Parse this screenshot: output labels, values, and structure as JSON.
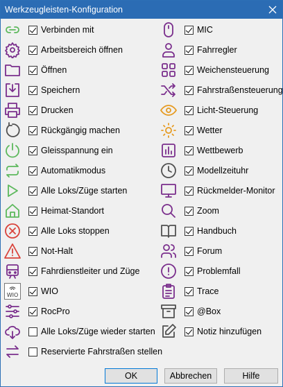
{
  "window": {
    "title": "Werkzeugleisten-Konfiguration"
  },
  "colors": {
    "green": "#5cb85c",
    "purple": "#7a2e8c",
    "red": "#d9423a",
    "orange": "#e69b22",
    "gray": "#505050",
    "titlebar": "#2b6cb4"
  },
  "left": [
    {
      "icon": "link-icon",
      "label": "Verbinden mit",
      "checked": true
    },
    {
      "icon": "gear-icon",
      "label": "Arbeitsbereich öffnen",
      "checked": true
    },
    {
      "icon": "folder-icon",
      "label": "Öffnen",
      "checked": true
    },
    {
      "icon": "save-icon",
      "label": "Speichern",
      "checked": true
    },
    {
      "icon": "printer-icon",
      "label": "Drucken",
      "checked": true
    },
    {
      "icon": "undo-icon",
      "label": "Rückgängig machen",
      "checked": true
    },
    {
      "icon": "power-icon",
      "label": "Gleisspannung ein",
      "checked": true
    },
    {
      "icon": "repeat-icon",
      "label": "Automatikmodus",
      "checked": true
    },
    {
      "icon": "play-icon",
      "label": "Alle Loks/Züge starten",
      "checked": true
    },
    {
      "icon": "home-icon",
      "label": "Heimat-Standort",
      "checked": true
    },
    {
      "icon": "stop-circle-icon",
      "label": "Alle Loks stoppen",
      "checked": true
    },
    {
      "icon": "warning-icon",
      "label": "Not-Halt",
      "checked": true
    },
    {
      "icon": "train-icon",
      "label": "Fahrdienstleiter und Züge",
      "checked": true
    },
    {
      "icon": "wio-icon",
      "label": "WIO",
      "checked": true
    },
    {
      "icon": "sliders-icon",
      "label": "RocPro",
      "checked": true
    },
    {
      "icon": "cloud-restart-icon",
      "label": "Alle Loks/Züge wieder starten",
      "checked": false
    },
    {
      "icon": "swap-arrows-icon",
      "label": "Reservierte Fahrstraßen stellen",
      "checked": false
    }
  ],
  "right": [
    {
      "icon": "mouse-icon",
      "label": "MIC",
      "checked": true
    },
    {
      "icon": "user-icon",
      "label": "Fahrregler",
      "checked": true
    },
    {
      "icon": "grid-icon",
      "label": "Weichensteuerung",
      "checked": true
    },
    {
      "icon": "shuffle-icon",
      "label": "Fahrstraßensteuerung",
      "checked": true
    },
    {
      "icon": "eye-icon",
      "label": "Licht-Steuerung",
      "checked": true
    },
    {
      "icon": "sun-icon",
      "label": "Wetter",
      "checked": true
    },
    {
      "icon": "bar-chart-icon",
      "label": "Wettbewerb",
      "checked": true
    },
    {
      "icon": "clock-icon",
      "label": "Modellzeituhr",
      "checked": true
    },
    {
      "icon": "monitor-icon",
      "label": "Rückmelder-Monitor",
      "checked": true
    },
    {
      "icon": "search-icon",
      "label": "Zoom",
      "checked": true
    },
    {
      "icon": "book-icon",
      "label": "Handbuch",
      "checked": true
    },
    {
      "icon": "users-icon",
      "label": "Forum",
      "checked": true
    },
    {
      "icon": "alert-circle-icon",
      "label": "Problemfall",
      "checked": true
    },
    {
      "icon": "clipboard-icon",
      "label": "Trace",
      "checked": true
    },
    {
      "icon": "archive-icon",
      "label": "@Box",
      "checked": true
    },
    {
      "icon": "edit-icon",
      "label": "Notiz hinzufügen",
      "checked": true
    }
  ],
  "buttons": {
    "ok": "OK",
    "cancel": "Abbrechen",
    "help": "Hilfe"
  }
}
